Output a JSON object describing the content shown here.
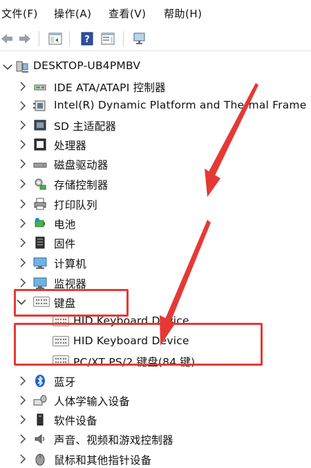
{
  "menu": {
    "file": "文件(F)",
    "action": "操作(A)",
    "view": "查看(V)",
    "help": "帮助(H)"
  },
  "toolbar": {
    "buttons": [
      "back",
      "forward",
      "show-hide-tree",
      "help",
      "properties",
      "monitor"
    ]
  },
  "tree": {
    "root": "DESKTOP-UB4PMBV",
    "items": [
      {
        "label": "IDE ATA/ATAPI 控制器",
        "icon": "disk-controller-icon"
      },
      {
        "label": "Intel(R) Dynamic Platform and Thermal Frame",
        "icon": "chip-icon"
      },
      {
        "label": "SD 主适配器",
        "icon": "sd-adapter-icon"
      },
      {
        "label": "处理器",
        "icon": "processor-icon"
      },
      {
        "label": "磁盘驱动器",
        "icon": "disk-drive-icon"
      },
      {
        "label": "存储控制器",
        "icon": "storage-controller-icon"
      },
      {
        "label": "打印队列",
        "icon": "printer-icon"
      },
      {
        "label": "电池",
        "icon": "battery-icon"
      },
      {
        "label": "固件",
        "icon": "firmware-icon"
      },
      {
        "label": "计算机",
        "icon": "computer-icon"
      },
      {
        "label": "监视器",
        "icon": "monitor-icon"
      },
      {
        "label": "键盘",
        "icon": "keyboard-icon",
        "expanded": true
      }
    ],
    "keyboard_children": [
      "HID Keyboard Device",
      "HID Keyboard Device",
      "PC/XT PS/2 键盘(84 键)"
    ],
    "after_items": [
      {
        "label": "蓝牙",
        "icon": "bluetooth-icon"
      },
      {
        "label": "人体学输入设备",
        "icon": "hid-icon"
      },
      {
        "label": "软件设备",
        "icon": "software-device-icon"
      },
      {
        "label": "声音、视频和游戏控制器",
        "icon": "sound-icon"
      },
      {
        "label": "鼠标和其他指针设备",
        "icon": "mouse-icon"
      }
    ]
  },
  "annotation_color": "#e53935"
}
